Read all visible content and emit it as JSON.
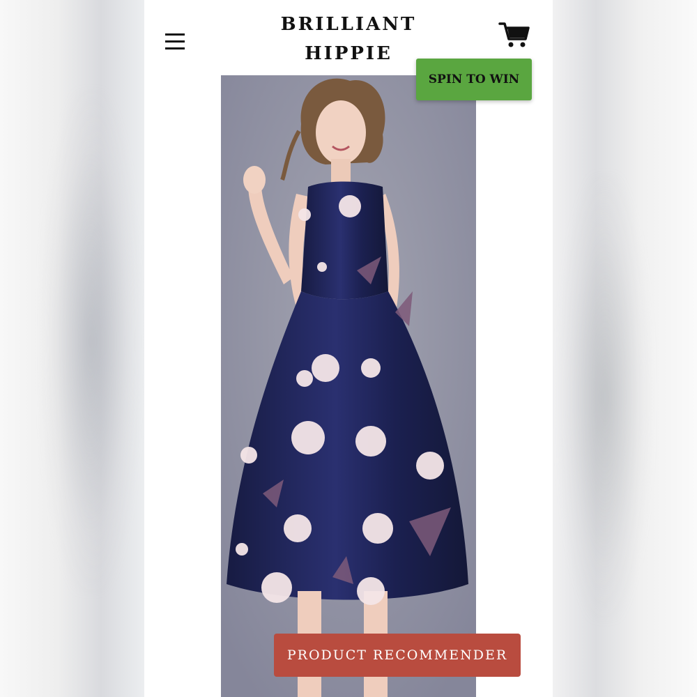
{
  "header": {
    "logo_line1": "BRILLIANT",
    "logo_line2": "HIPPIE",
    "menu_icon": "hamburger-menu-icon",
    "cart_icon": "shopping-cart-icon"
  },
  "promo": {
    "spin_label": "SPIN TO WIN",
    "spin_color": "#5aa640"
  },
  "product": {
    "image_subject": "navy floral satin sleeveless midi dress",
    "dress_color": "#1f2452",
    "flower_color": "#f5e6e8",
    "background_color": "#9a9ba8"
  },
  "cta": {
    "recommender_label": "PRODUCT RECOMMENDER",
    "recommender_color": "#b94c3f"
  }
}
